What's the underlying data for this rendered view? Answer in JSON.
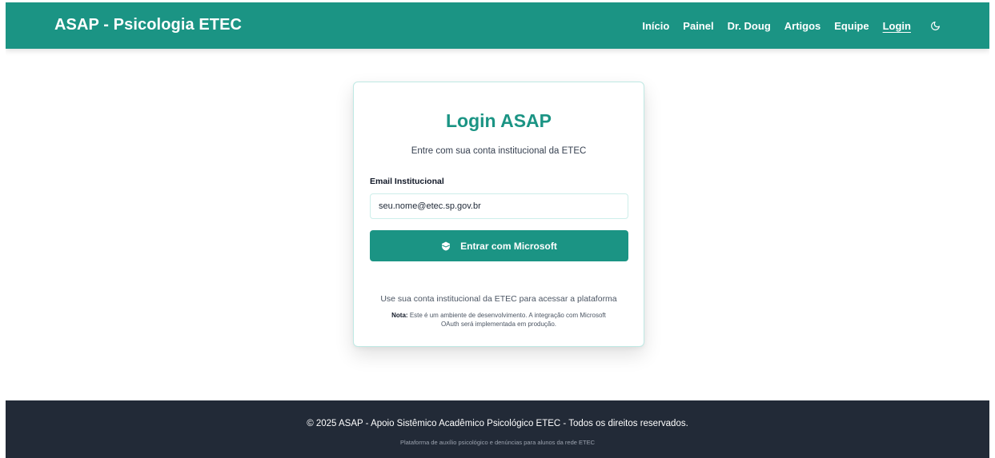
{
  "navbar": {
    "brand": "ASAP - Psicologia ETEC",
    "links": [
      "Início",
      "Painel",
      "Dr. Doug",
      "Artigos",
      "Equipe",
      "Login"
    ],
    "active_link": "Login",
    "theme_icon": "moon-icon"
  },
  "login_card": {
    "title": "Login ASAP",
    "subtitle": "Entre com sua conta institucional da ETEC",
    "email_label": "Email Institucional",
    "email_placeholder": "seu.nome@etec.sp.gov.br",
    "button_label": "Entrar com Microsoft",
    "button_icon": "shield-icon",
    "help_text": "Use sua conta institucional da ETEC para acessar a plataforma",
    "note_label": "Nota:",
    "note_text": "Este é um ambiente de desenvolvimento. A integração com Microsoft OAuth será implementada em produção."
  },
  "footer": {
    "main": "© 2025 ASAP - Apoio Sistêmico Acadêmico Psicológico ETEC - Todos os direitos reservados.",
    "sub": "Plataforma de auxílio psicológico e denúncias para alunos da rede ETEC"
  },
  "colors": {
    "primary": "#1b9484",
    "footer_bg": "#222a37"
  }
}
